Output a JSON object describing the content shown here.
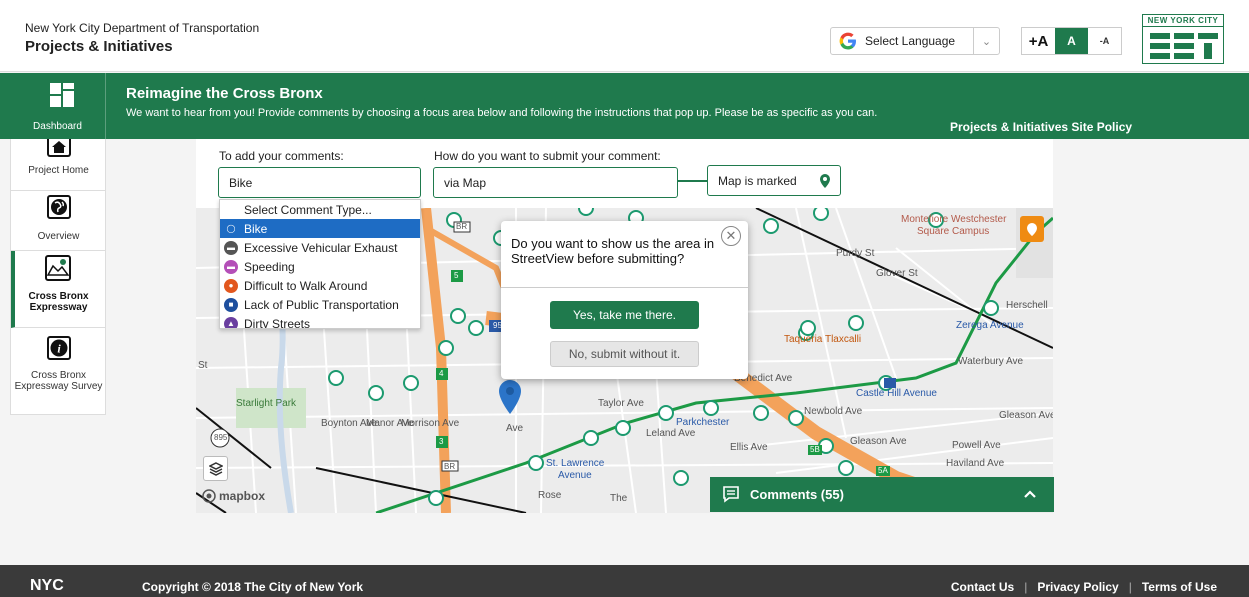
{
  "header": {
    "subtitle": "New York City Department of Transportation",
    "title": "Projects & Initiatives",
    "language_label": "Select Language",
    "font_sizes": [
      "+A",
      "A",
      "-A"
    ],
    "logo_text": "NEW YORK CITY"
  },
  "band": {
    "dashboard_label": "Dashboard",
    "title": "Reimagine the Cross Bronx",
    "description": "We want to hear from you! Provide comments by choosing a focus area below and following the instructions that pop up. Please be as specific as you can.",
    "policy_link": "Projects & Initiatives Site Policy"
  },
  "sidebar": {
    "items": [
      {
        "label": "Project Home",
        "icon": "home-icon"
      },
      {
        "label": "Overview",
        "icon": "globe-icon"
      },
      {
        "label": "Cross Bronx Expressway",
        "icon": "map-pin-icon",
        "active": true
      },
      {
        "label": "Cross Bronx Expressway Survey",
        "icon": "info-icon"
      }
    ]
  },
  "form": {
    "comment_label": "To add your comments:",
    "comment_value": "Bike",
    "submit_label": "How do you want to submit your comment:",
    "submit_value": "via Map",
    "map_status": "Map is marked"
  },
  "dropdown": {
    "items": [
      {
        "label": "Select Comment Type...",
        "color": ""
      },
      {
        "label": "Bike",
        "color": "#1e6cc4",
        "selected": true
      },
      {
        "label": "Excessive Vehicular Exhaust",
        "color": "#555555"
      },
      {
        "label": "Speeding",
        "color": "#b44fb8"
      },
      {
        "label": "Difficult to Walk Around",
        "color": "#e2571e"
      },
      {
        "label": "Lack of Public Transportation",
        "color": "#1e4f9e"
      },
      {
        "label": "Dirty Streets",
        "color": "#6a3fa0"
      }
    ]
  },
  "modal": {
    "question": "Do you want to show us the area in StreetView before submitting?",
    "yes_label": "Yes, take me there.",
    "no_label": "No, submit without it."
  },
  "comments": {
    "label": "Comments (55)"
  },
  "map": {
    "attribution": "mapbox",
    "labels": {
      "montefiore": "Montefiore Westchester",
      "montefiore2": "Square Campus",
      "starlight": "Starlight Park",
      "taqueria": "Taqueria Tlaxcalli",
      "castle_hill": "Castle Hill Avenue",
      "parkchester": "Parkchester",
      "st_lawrence": "St. Lawrence",
      "avenue": "Avenue",
      "waterbury": "Waterbury Ave",
      "newbold": "Newbold Ave",
      "gleason": "Gleason Ave",
      "gleason2": "Gleason Ave",
      "powell": "Powell Ave",
      "haviland": "Haviland Ave",
      "ellis": "Ellis Ave",
      "benedict": "Benedict Ave",
      "herschell": "Herschell",
      "zerega": "Zerega Avenue",
      "purdy": "Purdy St",
      "glover": "Glover St",
      "boynton": "Boynton Ave",
      "manor": "Manor Ave",
      "morrison": "Morrison Ave",
      "taylor": "Taylor Ave",
      "leland": "Leland Ave",
      "rose": "Rose",
      "the": "The",
      "i895": "895",
      "i95": "95",
      "br": "BR",
      "r5b": "5B",
      "r5a": "5A",
      "r5": "5",
      "r4": "4",
      "r3": "3",
      "st_left": "St",
      "ave_m": "Ave"
    }
  },
  "footer": {
    "logo": "NYC",
    "copyright": "Copyright © 2018 The City of New York",
    "links": [
      "Contact Us",
      "Privacy Policy",
      "Terms of Use"
    ]
  },
  "colors": {
    "brand_green": "#1f7a4d",
    "select_blue": "#1e6cc4",
    "footer_bg": "#3a3a3a",
    "orange": "#ef8b12"
  }
}
